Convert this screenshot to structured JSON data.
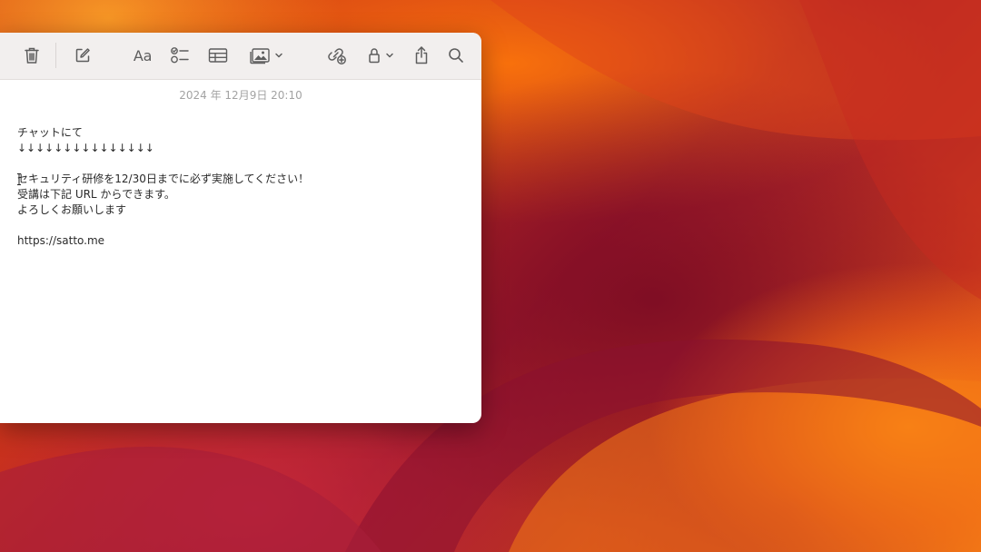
{
  "toolbar": {
    "items": [
      {
        "name": "delete",
        "icon": "trash-icon"
      },
      {
        "name": "compose",
        "icon": "compose-icon"
      },
      {
        "name": "format",
        "icon": "text-format-icon",
        "label": "Aa"
      },
      {
        "name": "checklist",
        "icon": "checklist-icon"
      },
      {
        "name": "table",
        "icon": "table-icon"
      },
      {
        "name": "media",
        "icon": "photo-icon"
      },
      {
        "name": "collaborate",
        "icon": "link-add-icon"
      },
      {
        "name": "lock",
        "icon": "lock-icon"
      },
      {
        "name": "share",
        "icon": "share-icon"
      },
      {
        "name": "search",
        "icon": "search-icon"
      }
    ]
  },
  "note": {
    "date": "2024 年 12月9日 20:10",
    "lines": [
      "チャットにて",
      "↓↓↓↓↓↓↓↓↓↓↓↓↓↓↓",
      "",
      "セキュリティ研修を12/30日までに必ず実施してください！",
      "受講は下記 URL からできます。",
      "よろしくお願いします",
      "",
      "https://satto.me"
    ]
  },
  "colors": {
    "toolbar_bg": "#f2efee",
    "window_bg": "#ffffff",
    "icon": "#5d5d5d",
    "date_text": "#a3a3a3",
    "body_text": "#2a2a2a"
  }
}
